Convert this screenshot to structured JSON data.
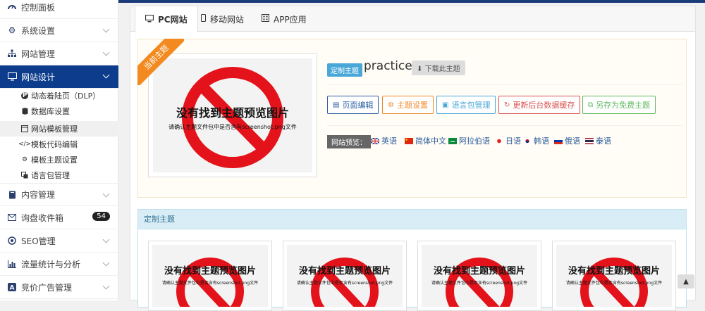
{
  "sidebar": {
    "items": [
      {
        "label": "控制面板",
        "icon": "dashboard-icon"
      },
      {
        "label": "系统设置",
        "icon": "gear-icon"
      },
      {
        "label": "网站管理",
        "icon": "sitemap-icon"
      },
      {
        "label": "网站设计",
        "icon": "monitor-icon"
      },
      {
        "label": "内容管理",
        "icon": "book-icon"
      },
      {
        "label": "询盘收件箱",
        "icon": "envelope-icon",
        "badge": "54"
      },
      {
        "label": "SEO管理",
        "icon": "target-icon"
      },
      {
        "label": "流量统计与分析",
        "icon": "bar-chart-icon"
      },
      {
        "label": "竞价广告管理",
        "icon": "ad-icon"
      }
    ],
    "subitems": [
      {
        "label": "动态着陆页（DLP）",
        "icon": "p-circle-icon"
      },
      {
        "label": "数据库设置",
        "icon": "database-icon"
      },
      {
        "label": "网站模板管理",
        "icon": "template-icon"
      },
      {
        "label": "模板代码编辑",
        "icon": "code-icon"
      },
      {
        "label": "模板主题设置",
        "icon": "gear-icon"
      },
      {
        "label": "语言包管理",
        "icon": "language-icon"
      }
    ]
  },
  "tabs": [
    {
      "label": "PC网站",
      "icon": "desktop-icon"
    },
    {
      "label": "移动网站",
      "icon": "mobile-icon"
    },
    {
      "label": "APP应用",
      "icon": "app-icon"
    }
  ],
  "current_theme": {
    "ribbon": "当前主题",
    "preview_title": "没有找到主题预览图片",
    "preview_sub": "请确认主题文件包中是否含有screenshot.png文件",
    "tag": "定制主题",
    "name": "practice",
    "download": "下载此主题",
    "actions": [
      {
        "label": "页面编辑",
        "color": "#2d5fa3",
        "icon": "file-icon"
      },
      {
        "label": "主题设置",
        "color": "#f0892b",
        "icon": "gear-icon"
      },
      {
        "label": "语言包管理",
        "color": "#4aa8d8",
        "icon": "language-icon"
      },
      {
        "label": "更新后台数据缓存",
        "color": "#d9534f",
        "icon": "refresh-icon"
      },
      {
        "label": "另存为免费主题",
        "color": "#5cb85c",
        "icon": "copy-icon"
      }
    ],
    "preview_label": "网站预览：",
    "languages": [
      {
        "label": "英语",
        "flag": "uk"
      },
      {
        "label": "简体中文",
        "flag": "cn"
      },
      {
        "label": "阿拉伯语",
        "flag": "sa"
      },
      {
        "label": "日语",
        "flag": "jp"
      },
      {
        "label": "韩语",
        "flag": "kr"
      },
      {
        "label": "俄语",
        "flag": "ru"
      },
      {
        "label": "泰语",
        "flag": "th"
      }
    ]
  },
  "custom_section": {
    "title": "定制主题",
    "thumbs": [
      {
        "title": "没有找到主题预览图片",
        "sub": "请确认主题文件包中是否含有screenshot.png文件"
      },
      {
        "title": "没有找到主题预览图片",
        "sub": "请确认主题文件包中是否含有screenshot.png文件"
      },
      {
        "title": "没有找到主题预览图片",
        "sub": "请确认主题文件包中是否含有screenshot.png文件"
      },
      {
        "title": "没有找到主题预览图片",
        "sub": "请确认主题文件包中是否含有screenshot.png文件"
      }
    ]
  },
  "scroll_top_icon": "chevron-up-icon"
}
